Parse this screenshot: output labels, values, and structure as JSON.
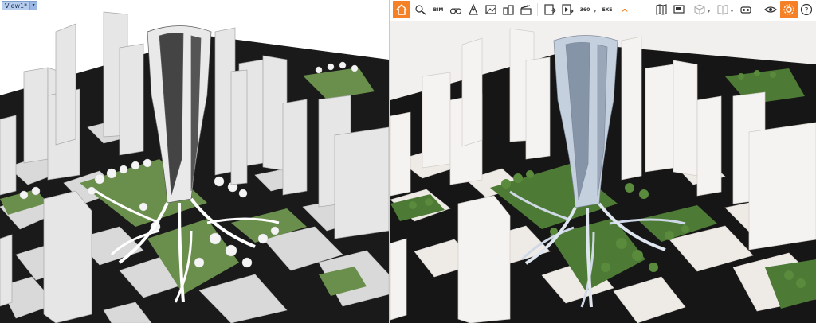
{
  "left_viewport": {
    "tab_label": "View1*",
    "tab_dropdown_icon": "chevron-down-icon",
    "colors": {
      "ground": "#1a1a1a",
      "blocks": "#dcdcdc",
      "grass": "#6a8f4c",
      "tower": "#e6e6e6"
    }
  },
  "toolbar": {
    "accent_color": "#f58025",
    "items": [
      {
        "name": "home",
        "icon": "home-icon",
        "active": true
      },
      {
        "name": "paint",
        "icon": "paint-icon"
      },
      {
        "name": "bim",
        "icon": "bim-icon",
        "label": "BIM"
      },
      {
        "name": "binoculars",
        "icon": "binoculars-icon"
      },
      {
        "name": "person",
        "icon": "person-icon"
      },
      {
        "name": "landscape",
        "icon": "landscape-icon"
      },
      {
        "name": "city",
        "icon": "city-icon"
      },
      {
        "name": "clapper",
        "icon": "clapper-icon"
      },
      {
        "name": "export-image",
        "icon": "export-image-icon"
      },
      {
        "name": "export-video",
        "icon": "export-video-icon"
      },
      {
        "name": "export-360",
        "icon": "export-360-icon",
        "label": "360"
      },
      {
        "name": "export-exe",
        "icon": "export-exe-icon",
        "label": "EXE"
      },
      {
        "name": "collapse",
        "icon": "chevron-up-icon"
      },
      {
        "name": "map",
        "icon": "map-icon"
      },
      {
        "name": "present",
        "icon": "presentation-icon"
      },
      {
        "name": "cube",
        "icon": "cube-icon"
      },
      {
        "name": "book",
        "icon": "book-icon"
      },
      {
        "name": "vr",
        "icon": "vr-headset-icon"
      },
      {
        "name": "eye",
        "icon": "eye-icon"
      },
      {
        "name": "settings",
        "icon": "gear-icon",
        "active": true
      },
      {
        "name": "help",
        "icon": "help-icon",
        "label": "?"
      }
    ]
  },
  "right_viewport": {
    "colors": {
      "sky": "#f2f0ee",
      "ground": "#161616",
      "blocks": "#eeeae6",
      "grass": "#4d7a35",
      "tower": "#c5d0de"
    }
  }
}
